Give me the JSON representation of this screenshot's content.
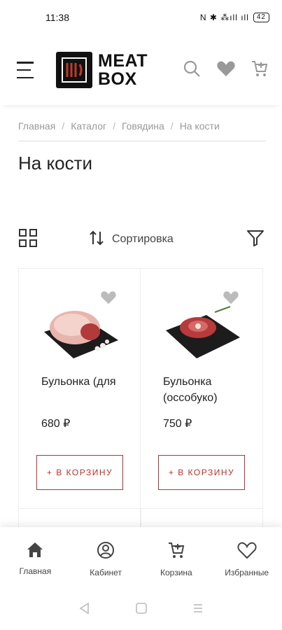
{
  "status": {
    "time": "11:38",
    "icons": "N ✱ ⁂ıll ıll",
    "battery": "42"
  },
  "header": {
    "logo_line1": "MEAT",
    "logo_line2": "BOX"
  },
  "breadcrumb": [
    "Главная",
    "Каталог",
    "Говядина",
    "На кости"
  ],
  "page_title": "На кости",
  "toolbar": {
    "sort_label": "Сортировка"
  },
  "products": [
    {
      "name": "Бульонка (для",
      "price": "680 ₽",
      "cart_label": "+ В КОРЗИНУ"
    },
    {
      "name": "Бульонка (оссобуко)",
      "price": "750 ₽",
      "cart_label": "+ В КОРЗИНУ"
    }
  ],
  "bottom_nav": [
    {
      "label": "Главная",
      "icon": "home-icon"
    },
    {
      "label": "Кабинет",
      "icon": "user-icon"
    },
    {
      "label": "Корзина",
      "icon": "cart-icon"
    },
    {
      "label": "Избранные",
      "icon": "heart-icon"
    }
  ],
  "colors": {
    "accent": "#b5332e",
    "text": "#222222",
    "muted": "#999999"
  }
}
